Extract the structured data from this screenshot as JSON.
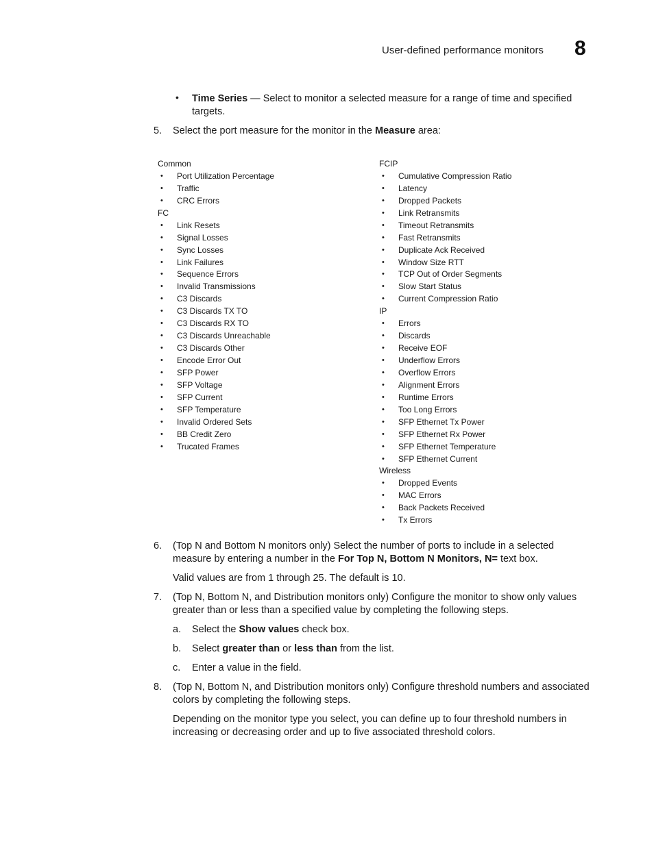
{
  "header": {
    "section_title": "User-defined performance monitors",
    "chapter_number": "8"
  },
  "intro_bullet": {
    "term": "Time Series",
    "text_line1": " — Select to monitor a selected measure for a range of time and specified",
    "text_line2": "targets."
  },
  "steps": {
    "step5": {
      "number": "5.",
      "text_before": "Select the port measure for the monitor in the ",
      "bold": "Measure",
      "text_after": " area:"
    },
    "step6": {
      "number": "6.",
      "line1": "(Top N and Bottom N monitors only) Select the number of ports to include in a selected",
      "line2_before": "measure by entering a number in the ",
      "line2_bold": "For Top N, Bottom N Monitors, N=",
      "line2_after": " text box.",
      "note": "Valid values are from 1 through 25. The default is 10."
    },
    "step7": {
      "number": "7.",
      "line1": "(Top N, Bottom N, and Distribution monitors only) Configure the monitor to show only values",
      "line2": "greater than or less than a specified value by completing the following steps.",
      "substeps": {
        "a": {
          "label": "a.",
          "before": "Select the ",
          "bold": "Show values",
          "after": " check box."
        },
        "b": {
          "label": "b.",
          "before": "Select ",
          "bold1": "greater than",
          "mid": " or ",
          "bold2": "less than",
          "after": " from the list."
        },
        "c": {
          "label": "c.",
          "text": "Enter a value in the field."
        }
      }
    },
    "step8": {
      "number": "8.",
      "line1": "(Top N, Bottom N, and Distribution monitors only) Configure threshold numbers and associated",
      "line2": "colors by completing the following steps.",
      "note_line1": "Depending on the monitor type you select, you can define up to four threshold numbers in",
      "note_line2": "increasing or decreasing order and up to five associated threshold colors."
    }
  },
  "measures": {
    "left_column": [
      {
        "group": "Common",
        "items": [
          "Port Utilization Percentage",
          "Traffic",
          "CRC Errors"
        ]
      },
      {
        "group": "FC",
        "items": [
          "Link Resets",
          "Signal Losses",
          "Sync Losses",
          "Link Failures",
          "Sequence Errors",
          "Invalid Transmissions",
          "C3 Discards",
          "C3 Discards TX TO",
          "C3 Discards RX TO",
          "C3 Discards Unreachable",
          "C3 Discards Other",
          "Encode Error Out",
          "SFP Power",
          "SFP Voltage",
          "SFP Current",
          "SFP Temperature",
          "Invalid Ordered Sets",
          "BB Credit Zero",
          "Trucated Frames"
        ]
      }
    ],
    "right_column": [
      {
        "group": "FCIP",
        "items": [
          "Cumulative Compression Ratio",
          "Latency",
          "Dropped Packets",
          "Link Retransmits",
          "Timeout Retransmits",
          "Fast Retransmits",
          "Duplicate Ack Received",
          "Window Size RTT",
          "TCP Out of Order Segments",
          "Slow Start Status",
          "Current Compression Ratio"
        ]
      },
      {
        "group": "IP",
        "items": [
          "Errors",
          "Discards",
          "Receive EOF",
          "Underflow Errors",
          "Overflow Errors",
          "Alignment Errors",
          "Runtime Errors",
          "Too Long Errors",
          "SFP Ethernet Tx Power",
          "SFP Ethernet Rx Power",
          "SFP Ethernet Temperature",
          "SFP Ethernet Current"
        ]
      },
      {
        "group": "Wireless",
        "items": [
          "Dropped Events",
          "MAC Errors",
          "Back Packets Received",
          "Tx Errors"
        ]
      }
    ],
    "bullet_glyph": "•"
  }
}
